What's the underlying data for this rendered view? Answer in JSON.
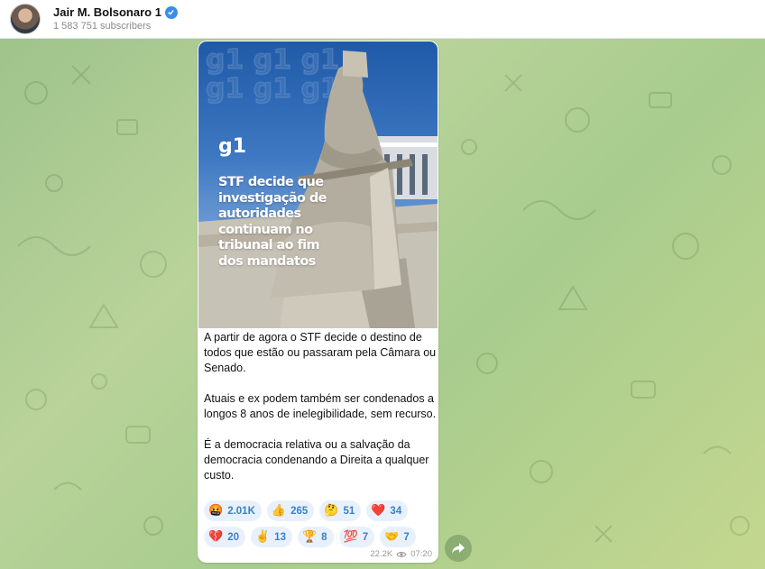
{
  "header": {
    "channel_name": "Jair M. Bolsonaro 1",
    "subscribers": "1 583 751 subscribers",
    "verified_icon": "verified-badge-icon"
  },
  "post": {
    "image": {
      "logo": "g1",
      "headline": "STF decide que investigação de autoridades continuam no tribunal ao fim dos mandatos"
    },
    "text": "A partir de agora o STF decide o destino de todos que estão ou passaram pela Câmara ou Senado.\n\nAtuais e ex podem também ser condenados a longos 8 anos de inelegibilidade, sem recurso.\n\nÉ a democracia relativa ou a salvação da democracia condenando a Direita a qualquer custo.",
    "reactions": [
      {
        "emoji": "🤬",
        "count": "2.01K"
      },
      {
        "emoji": "👍",
        "count": "265"
      },
      {
        "emoji": "🤔",
        "count": "51"
      },
      {
        "emoji": "❤️",
        "count": "34"
      },
      {
        "emoji": "💔",
        "count": "20"
      },
      {
        "emoji": "✌️",
        "count": "13"
      },
      {
        "emoji": "🏆",
        "count": "8"
      },
      {
        "emoji": "💯",
        "count": "7"
      },
      {
        "emoji": "🤝",
        "count": "7"
      }
    ],
    "views": "22.2K",
    "time": "07:20"
  },
  "colors": {
    "accent": "#3a80c9",
    "reaction_bg": "#e8f1fb",
    "verified": "#3a8ee6"
  }
}
